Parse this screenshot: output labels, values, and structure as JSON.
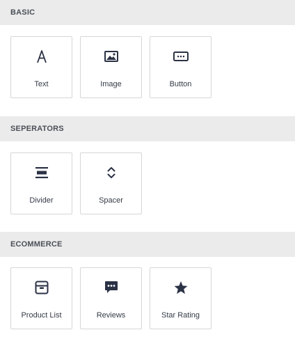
{
  "sections": [
    {
      "title": "BASIC",
      "blocks": [
        {
          "label": "Text",
          "icon": "text-icon"
        },
        {
          "label": "Image",
          "icon": "image-icon"
        },
        {
          "label": "Button",
          "icon": "button-icon"
        }
      ]
    },
    {
      "title": "SEPERATORS",
      "blocks": [
        {
          "label": "Divider",
          "icon": "divider-icon"
        },
        {
          "label": "Spacer",
          "icon": "spacer-icon"
        }
      ]
    },
    {
      "title": "ECOMMERCE",
      "blocks": [
        {
          "label": "Product List",
          "icon": "product-list-icon"
        },
        {
          "label": "Reviews",
          "icon": "reviews-icon"
        },
        {
          "label": "Star Rating",
          "icon": "star-rating-icon"
        }
      ]
    }
  ],
  "colors": {
    "header_bg": "#ebebeb",
    "icon": "#2b3245",
    "tile_border": "#d6d6d6",
    "text": "#333a45"
  }
}
